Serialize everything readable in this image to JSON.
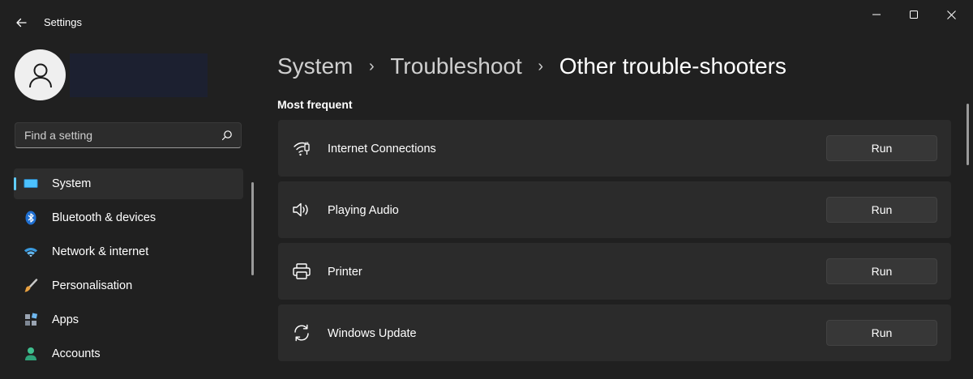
{
  "window": {
    "title": "Settings",
    "controls": {
      "minimize_icon": "minimize-icon",
      "maximize_icon": "maximize-icon",
      "close_icon": "close-icon"
    }
  },
  "sidebar": {
    "search": {
      "placeholder": "Find a setting",
      "value": ""
    },
    "items": [
      {
        "label": "System",
        "icon": "system-monitor-icon",
        "active": true
      },
      {
        "label": "Bluetooth & devices",
        "icon": "bluetooth-icon",
        "active": false
      },
      {
        "label": "Network & internet",
        "icon": "wifi-icon",
        "active": false
      },
      {
        "label": "Personalisation",
        "icon": "paintbrush-icon",
        "active": false
      },
      {
        "label": "Apps",
        "icon": "apps-icon",
        "active": false
      },
      {
        "label": "Accounts",
        "icon": "person-icon",
        "active": false
      }
    ]
  },
  "main": {
    "breadcrumb": [
      "System",
      "Troubleshoot",
      "Other trouble-shooters"
    ],
    "breadcrumb_separator": "›",
    "section_title": "Most frequent",
    "troubleshooters": [
      {
        "label": "Internet Connections",
        "icon": "wifi-signal-icon",
        "button": "Run"
      },
      {
        "label": "Playing Audio",
        "icon": "speaker-icon",
        "button": "Run"
      },
      {
        "label": "Printer",
        "icon": "printer-icon",
        "button": "Run"
      },
      {
        "label": "Windows Update",
        "icon": "sync-icon",
        "button": "Run"
      }
    ]
  },
  "colors": {
    "background": "#202020",
    "card": "#2b2b2b",
    "button": "#373737",
    "accent": "#60cdff"
  }
}
